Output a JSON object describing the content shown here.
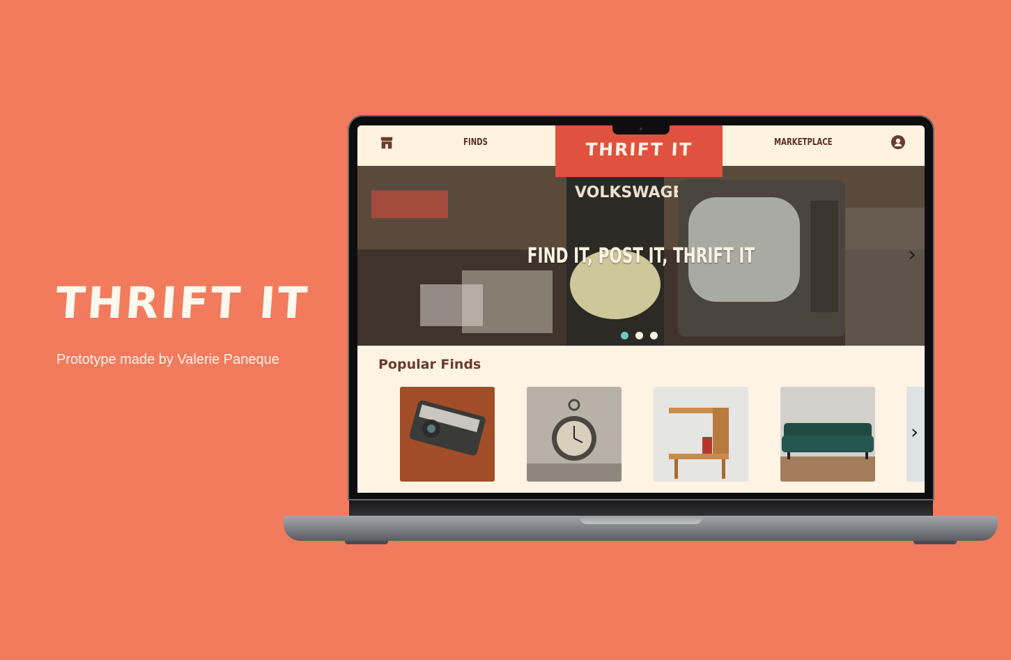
{
  "hero": {
    "title": "THRIFT IT",
    "subtitle": "Prototype made by Valerie Paneque"
  },
  "app": {
    "nav": {
      "home_icon": "store-icon",
      "finds_label": "FINDS",
      "brand": "THRIFT IT",
      "marketplace_label": "MARKETPLACE",
      "account_icon": "user-circle-icon"
    },
    "banner": {
      "caption": "FIND IT, POST IT, THRIFT IT",
      "next_label": "›",
      "slides_total": 3,
      "active_slide": 1
    },
    "popular": {
      "title": "Popular Finds",
      "items": [
        "camera",
        "alarm-clock",
        "side-table",
        "sofa"
      ],
      "next_label": "›"
    }
  },
  "colors": {
    "background": "#f27b5e",
    "brand_red": "#e0523f",
    "cream": "#fff3e4",
    "brown": "#6b3a2c",
    "dot_active": "#6fc7c2"
  }
}
